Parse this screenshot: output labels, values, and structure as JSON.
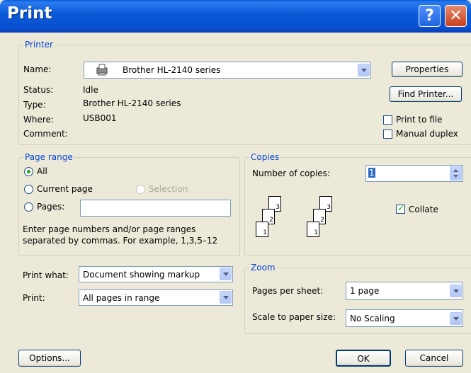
{
  "window": {
    "title": "Print"
  },
  "title_buttons": {
    "help": "?",
    "close": "✕"
  },
  "printer": {
    "legend": "Printer",
    "name_label": "Name:",
    "name_value": "Brother HL-2140 series",
    "status_label": "Status:",
    "status_value": "Idle",
    "type_label": "Type:",
    "type_value": "Brother HL-2140 series",
    "where_label": "Where:",
    "where_value": "USB001",
    "comment_label": "Comment:",
    "properties_button": "Properties",
    "find_printer_button": "Find Printer...",
    "print_to_file": "Print to file",
    "manual_duplex": "Manual duplex"
  },
  "page_range": {
    "legend": "Page range",
    "all": "All",
    "current_page": "Current page",
    "selection": "Selection",
    "pages": "Pages:",
    "pages_value": "",
    "help_line1": "Enter page numbers and/or page ranges",
    "help_line2": "separated by commas.  For example, 1,3,5–12"
  },
  "copies": {
    "legend": "Copies",
    "number_label": "Number of copies:",
    "number_value": "1",
    "collate": "Collate",
    "page_numbers": [
      "3",
      "2",
      "1"
    ]
  },
  "print_what": {
    "label": "Print what:",
    "value": "Document showing markup"
  },
  "print_select": {
    "label": "Print:",
    "value": "All pages in range"
  },
  "zoom": {
    "legend": "Zoom",
    "pages_per_sheet_label": "Pages per sheet:",
    "pages_per_sheet_value": "1 page",
    "scale_label": "Scale to paper size:",
    "scale_value": "No Scaling"
  },
  "footer": {
    "options": "Options...",
    "ok": "OK",
    "cancel": "Cancel"
  },
  "colors": {
    "titlebar": "#0a5ddb",
    "legend": "#0046d5",
    "dialog_bg": "#ece9d8"
  }
}
